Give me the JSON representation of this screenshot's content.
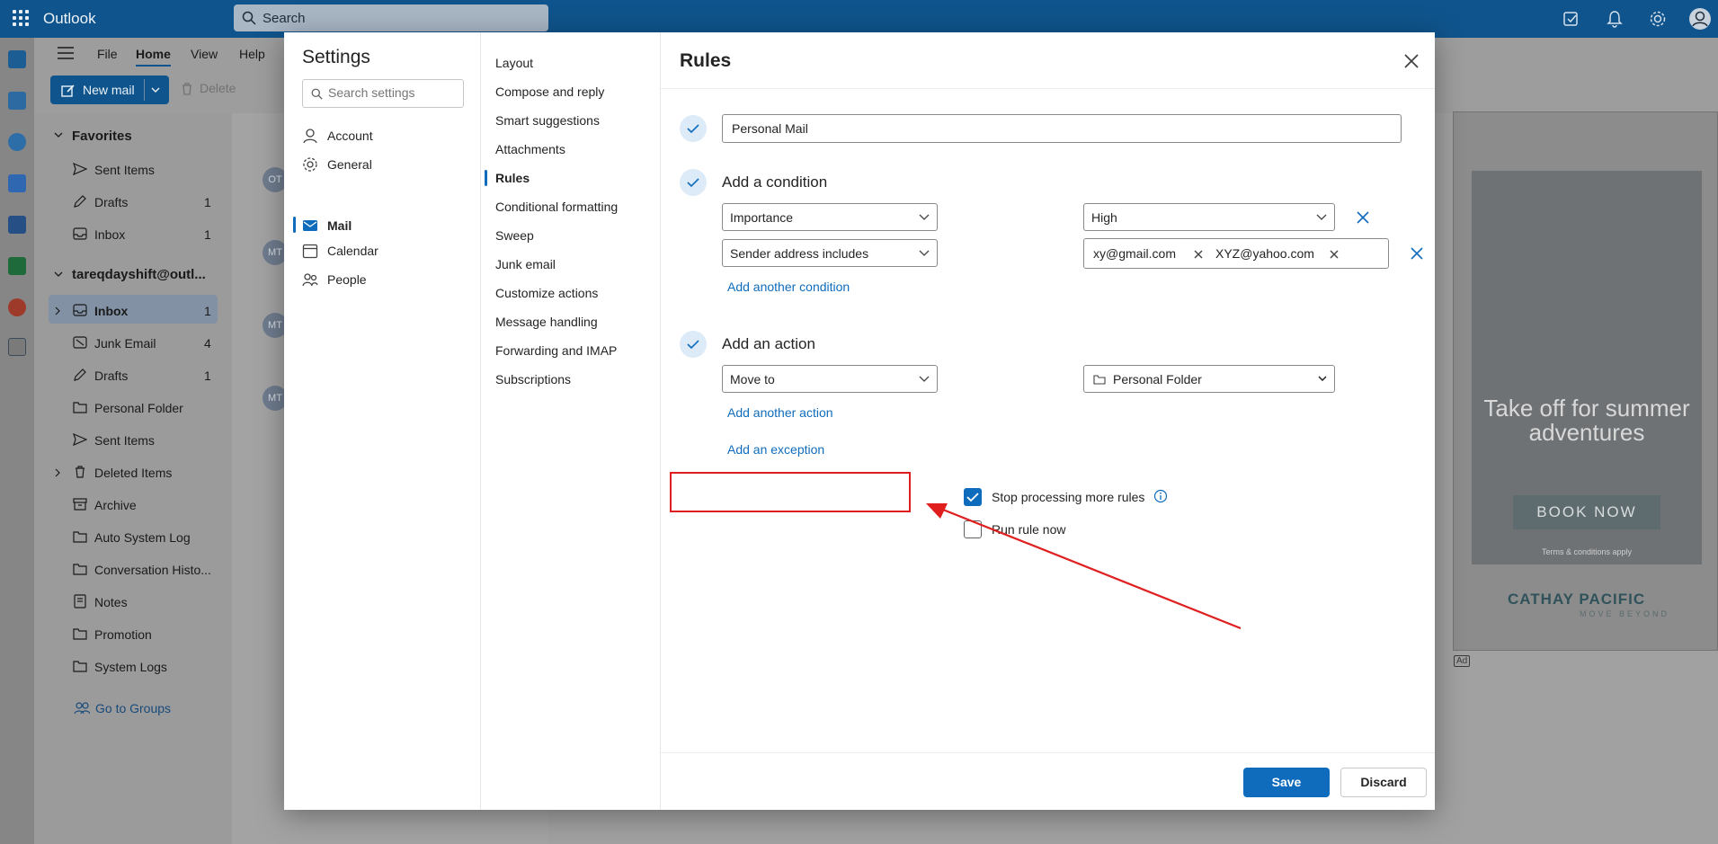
{
  "app": {
    "name": "Outlook"
  },
  "search": {
    "label": "Search"
  },
  "ribbon": {
    "tabs": [
      "File",
      "Home",
      "View",
      "Help"
    ],
    "new_mail": "New mail",
    "delete": "Delete"
  },
  "folders": {
    "favorites_header": "Favorites",
    "favorites": [
      {
        "label": "Sent Items",
        "count": ""
      },
      {
        "label": "Drafts",
        "count": "1"
      },
      {
        "label": "Inbox",
        "count": "1"
      }
    ],
    "account_header": "tareqdayshift@outl...",
    "items": [
      {
        "label": "Inbox",
        "count": "1"
      },
      {
        "label": "Junk Email",
        "count": "4"
      },
      {
        "label": "Drafts",
        "count": "1"
      },
      {
        "label": "Personal Folder",
        "count": ""
      },
      {
        "label": "Sent Items",
        "count": ""
      },
      {
        "label": "Deleted Items",
        "count": ""
      },
      {
        "label": "Archive",
        "count": ""
      },
      {
        "label": "Auto System Log",
        "count": ""
      },
      {
        "label": "Conversation Histo...",
        "count": ""
      },
      {
        "label": "Notes",
        "count": ""
      },
      {
        "label": "Promotion",
        "count": ""
      },
      {
        "label": "System Logs",
        "count": ""
      }
    ],
    "go_to_groups": "Go to Groups"
  },
  "message_list": {
    "avatars": [
      "OT",
      "MT",
      "MT",
      "MT"
    ]
  },
  "ad": {
    "headline": "Take off for summer adventures",
    "button": "BOOK NOW",
    "terms": "Terms & conditions apply",
    "brand": "CATHAY PACIFIC",
    "tagline": "MOVE BEYOND",
    "label": "Ad"
  },
  "settings": {
    "title": "Settings",
    "search_placeholder": "Search settings",
    "nav": [
      "Account",
      "General",
      "Mail",
      "Calendar",
      "People"
    ],
    "active_nav": "Mail",
    "subnav": [
      "Layout",
      "Compose and reply",
      "Smart suggestions",
      "Attachments",
      "Rules",
      "Conditional formatting",
      "Sweep",
      "Junk email",
      "Customize actions",
      "Message handling",
      "Forwarding and IMAP",
      "Subscriptions"
    ],
    "active_subnav": "Rules"
  },
  "rules": {
    "title": "Rules",
    "rule_name": "Personal Mail",
    "condition_header": "Add a condition",
    "conditions": [
      {
        "field": "Importance",
        "value": "High"
      },
      {
        "field": "Sender address includes",
        "tags": [
          "xy@gmail.com",
          "XYZ@yahoo.com"
        ]
      }
    ],
    "add_condition": "Add another condition",
    "action_header": "Add an action",
    "action": {
      "field": "Move to",
      "value": "Personal Folder"
    },
    "add_action": "Add another action",
    "add_exception": "Add an exception",
    "stop_processing": {
      "label": "Stop processing more rules",
      "checked": true
    },
    "run_now": {
      "label": "Run rule now",
      "checked": false
    },
    "save": "Save",
    "discard": "Discard"
  },
  "colors": {
    "accent": "#0f6cbd",
    "brand_bar": "#0f548c",
    "highlight": "#e01e1e"
  }
}
